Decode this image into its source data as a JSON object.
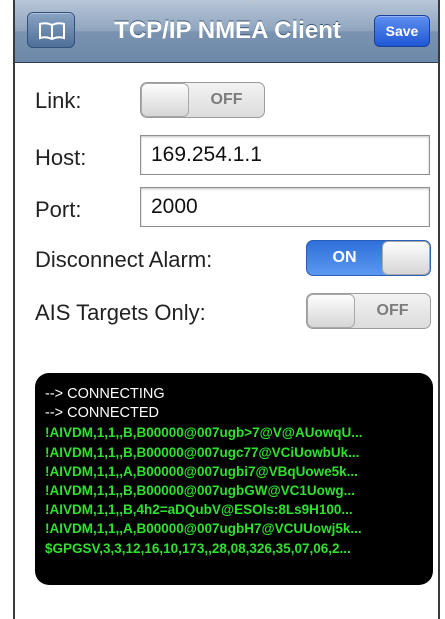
{
  "navbar": {
    "title": "TCP/IP NMEA Client",
    "save_label": "Save",
    "left_icon": "book-icon"
  },
  "form": {
    "link": {
      "label": "Link:",
      "state": "OFF"
    },
    "host": {
      "label": "Host:",
      "value": "169.254.1.1"
    },
    "port": {
      "label": "Port:",
      "value": "2000"
    },
    "disconnect_alarm": {
      "label": "Disconnect Alarm:",
      "state": "ON"
    },
    "ais_targets_only": {
      "label": "AIS Targets Only:",
      "state": "OFF"
    }
  },
  "console": {
    "status_lines": [
      "--> CONNECTING",
      "--> CONNECTED"
    ],
    "nmea_lines": [
      "!AIVDM,1,1,,B,B00000@007ugb>7@V@AUowqU...",
      "!AIVDM,1,1,,B,B00000@007ugc77@VCiUowbUk...",
      "!AIVDM,1,1,,A,B00000@007ugbi7@VBqUowe5k...",
      "!AIVDM,1,1,,B,B00000@007ugbGW@VC1Uowg...",
      "!AIVDM,1,1,,B,4h2=aDQubV@ESOls:8Ls9H100...",
      "!AIVDM,1,1,,A,B00000@007ugbH7@VCUUowj5k...",
      "$GPGSV,3,3,12,16,10,173,,28,08,326,35,07,06,2..."
    ]
  },
  "colors": {
    "navbar": "#7a93b1",
    "switch_on": "#3b7fe6",
    "console_bg": "#000000",
    "nmea_text": "#2fe02f"
  }
}
